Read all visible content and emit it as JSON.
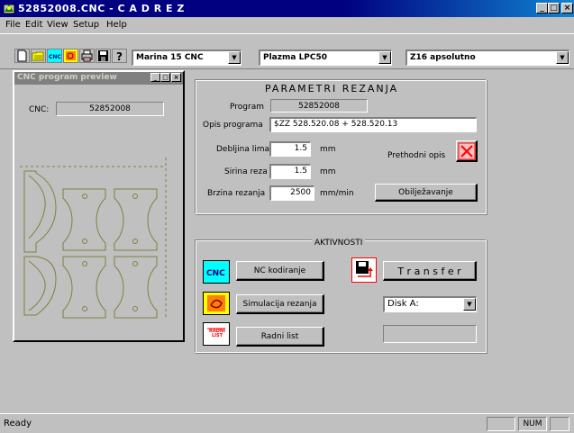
{
  "window": {
    "title": "52852008.CNC - C A D R E Z",
    "buttons": [
      "_",
      "□",
      "×"
    ]
  },
  "menu": [
    "File",
    "Edit",
    "View",
    "Setup",
    "Help"
  ],
  "toolbar": {
    "icons": [
      "new-file-icon",
      "open-folder-icon",
      "cnc-icon",
      "simulation-icon",
      "print-icon",
      "save-icon",
      "help-icon"
    ],
    "combos": [
      "Marina 15 CNC",
      "Plazma LPC50",
      "Z16 apsolutno"
    ]
  },
  "preview": {
    "title": "CNC program preview",
    "cnc_label": "CNC:",
    "cnc_value": "52852008"
  },
  "params": {
    "title": "PARAMETRI REZANJA",
    "program_label": "Program",
    "program_value": "52852008",
    "opis_label": "Opis programa",
    "opis_value": "$ZZ 528.520.08 + 528.520.13",
    "debljina_label": "Debljina lima",
    "debljina_value": "1.5",
    "debljina_unit": "mm",
    "sirina_label": "Sirina reza",
    "sirina_value": "1.5",
    "sirina_unit": "mm",
    "brzina_label": "Brzina rezanja",
    "brzina_value": "2500",
    "brzina_unit": "mm/min",
    "prethodni_label": "Prethodni opis",
    "obiljezavanje_label": "Obilježavanje"
  },
  "aktivnosti": {
    "title": "AKTIVNOSTI",
    "nc_label": "NC kodiranje",
    "sim_label": "Simulacija rezanja",
    "radni_label": "Radni list",
    "transfer_label": "T r a n s f e r",
    "disk_value": "Disk  A:",
    "radni_icon_text": "RADNI LIST"
  },
  "status": {
    "text": "Ready",
    "num": "NUM"
  },
  "colors": {
    "title_bar": "#000080",
    "cnc_icon_bg": "#00ffff",
    "sim_icon_bg": "#ffff00",
    "transfer_accent": "#ff0000",
    "drawing_line": "#808040"
  }
}
